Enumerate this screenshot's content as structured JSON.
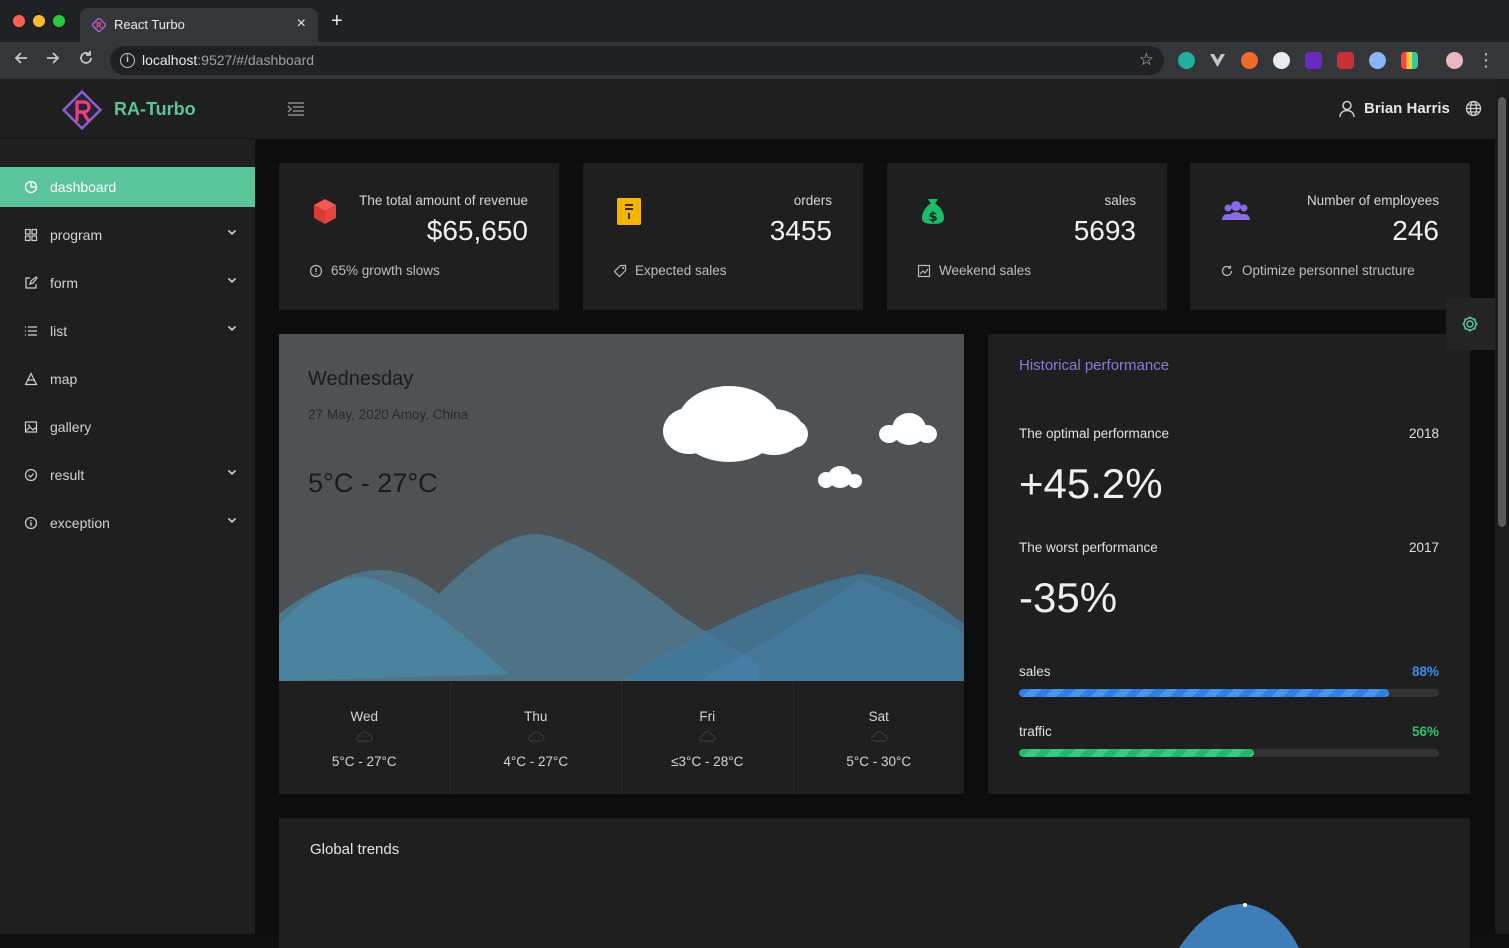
{
  "browser": {
    "tab_title": "React Turbo",
    "tab_close": "×",
    "new_tab": "+",
    "url_host": "localhost",
    "url_rest": ":9527/#/dashboard"
  },
  "app": {
    "brand": "RA-Turbo",
    "user_name": "Brian Harris"
  },
  "sidebar": {
    "items": [
      {
        "label": "dashboard",
        "icon": "pie-chart-icon",
        "active": true
      },
      {
        "label": "program",
        "icon": "grid-icon",
        "has_children": true
      },
      {
        "label": "form",
        "icon": "edit-icon",
        "has_children": true
      },
      {
        "label": "list",
        "icon": "list-icon",
        "has_children": true
      },
      {
        "label": "map",
        "icon": "map-icon"
      },
      {
        "label": "gallery",
        "icon": "image-icon"
      },
      {
        "label": "result",
        "icon": "check-circle-icon",
        "has_children": true
      },
      {
        "label": "exception",
        "icon": "info-circle-icon",
        "has_children": true
      }
    ]
  },
  "stats": [
    {
      "label": "The total amount of revenue",
      "value": "$65,650",
      "footer": "65% growth slows",
      "icon": "cube-icon",
      "color": "#e8433f"
    },
    {
      "label": "orders",
      "value": "3455",
      "footer": "Expected sales",
      "icon": "receipt-icon",
      "color": "#f5b400"
    },
    {
      "label": "sales",
      "value": "5693",
      "footer": "Weekend sales",
      "icon": "money-bag-icon",
      "color": "#1fba6a"
    },
    {
      "label": "Number of employees",
      "value": "246",
      "footer": "Optimize personnel structure",
      "icon": "team-icon",
      "color": "#8a6ae6"
    }
  ],
  "weather": {
    "day": "Wednesday",
    "date_location": "27 May, 2020 Amoy, China",
    "temp_range": "5°C - 27°C",
    "forecast": [
      {
        "day": "Wed",
        "temp": "5°C - 27°C"
      },
      {
        "day": "Thu",
        "temp": "4°C - 27°C"
      },
      {
        "day": "Fri",
        "temp": "≤3°C - 28°C"
      },
      {
        "day": "Sat",
        "temp": "5°C - 30°C"
      }
    ]
  },
  "performance": {
    "title": "Historical performance",
    "optimal_label": "The optimal performance",
    "optimal_year": "2018",
    "optimal_value": "+45.2%",
    "worst_label": "The worst performance",
    "worst_year": "2017",
    "worst_value": "-35%",
    "bars": [
      {
        "label": "sales",
        "pct": "88%",
        "value": 0.88,
        "color": "#2f7fe6"
      },
      {
        "label": "traffic",
        "pct": "56%",
        "value": 0.56,
        "color": "#1fb86c"
      }
    ]
  },
  "trends": {
    "title": "Global trends"
  },
  "colors": {
    "accent": "#5cc49a",
    "purple_title": "#8a7bd8"
  }
}
